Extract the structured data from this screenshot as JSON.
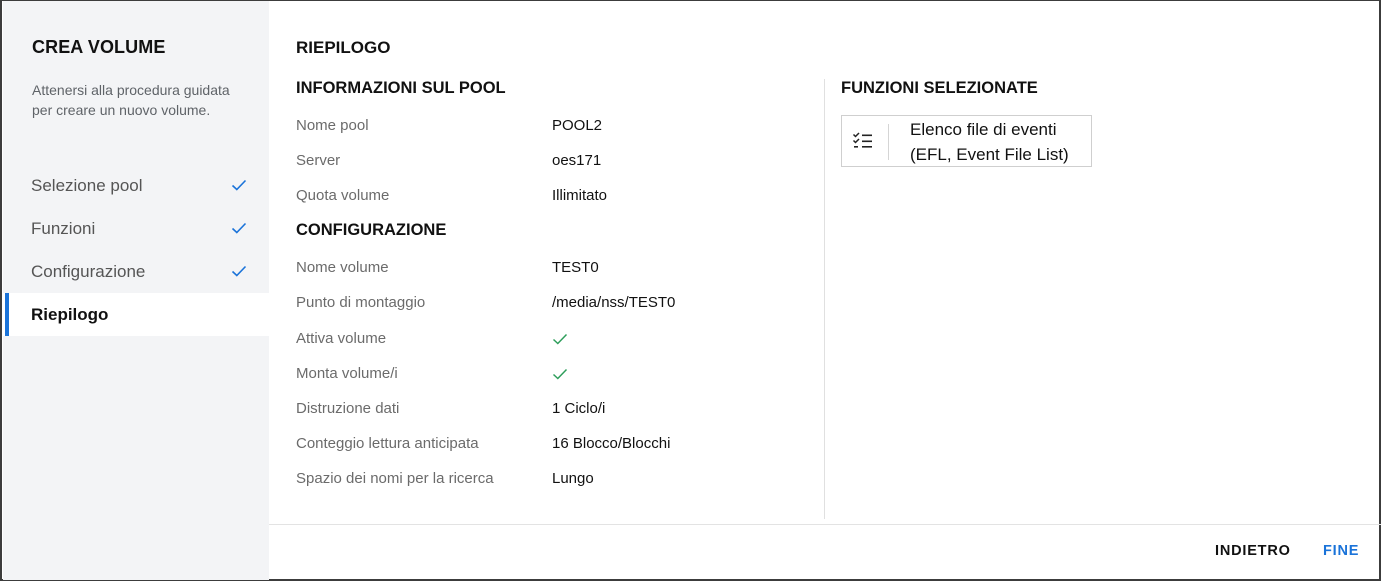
{
  "sidebar": {
    "title": "CREA VOLUME",
    "description": "Attenersi alla procedura guidata per creare un nuovo volume.",
    "steps": [
      {
        "label": "Selezione pool",
        "completed": true
      },
      {
        "label": "Funzioni",
        "completed": true
      },
      {
        "label": "Configurazione",
        "completed": true
      },
      {
        "label": "Riepilogo",
        "completed": false,
        "active": true
      }
    ]
  },
  "main": {
    "title": "RIEPILOGO",
    "pool_info": {
      "title": "INFORMAZIONI SUL POOL",
      "rows": [
        {
          "label": "Nome pool",
          "value": "POOL2"
        },
        {
          "label": "Server",
          "value": "oes171"
        },
        {
          "label": "Quota volume",
          "value": "Illimitato"
        }
      ]
    },
    "configuration": {
      "title": "CONFIGURAZIONE",
      "rows": [
        {
          "label": "Nome volume",
          "value": "TEST0"
        },
        {
          "label": "Punto di montaggio",
          "value": "/media/nss/TEST0"
        },
        {
          "label": "Attiva volume",
          "value": "",
          "icon": "check-icon"
        },
        {
          "label": "Monta volume/i",
          "value": "",
          "icon": "check-icon"
        },
        {
          "label": "Distruzione dati",
          "value": "1 Ciclo/i"
        },
        {
          "label": "Conteggio lettura anticipata",
          "value": "16 Blocco/Blocchi"
        },
        {
          "label": "Spazio dei nomi per la ricerca",
          "value": "Lungo"
        }
      ]
    },
    "features": {
      "title": "FUNZIONI SELEZIONATE",
      "items": [
        {
          "icon": "checklist-icon",
          "label": "Elenco file di eventi (EFL, Event File List)"
        }
      ]
    }
  },
  "footer": {
    "back_label": "INDIETRO",
    "finish_label": "FINE"
  },
  "colors": {
    "accent": "#1a73d9",
    "check_green": "#2e9e5b",
    "sidebar_bg": "#f3f4f6"
  }
}
